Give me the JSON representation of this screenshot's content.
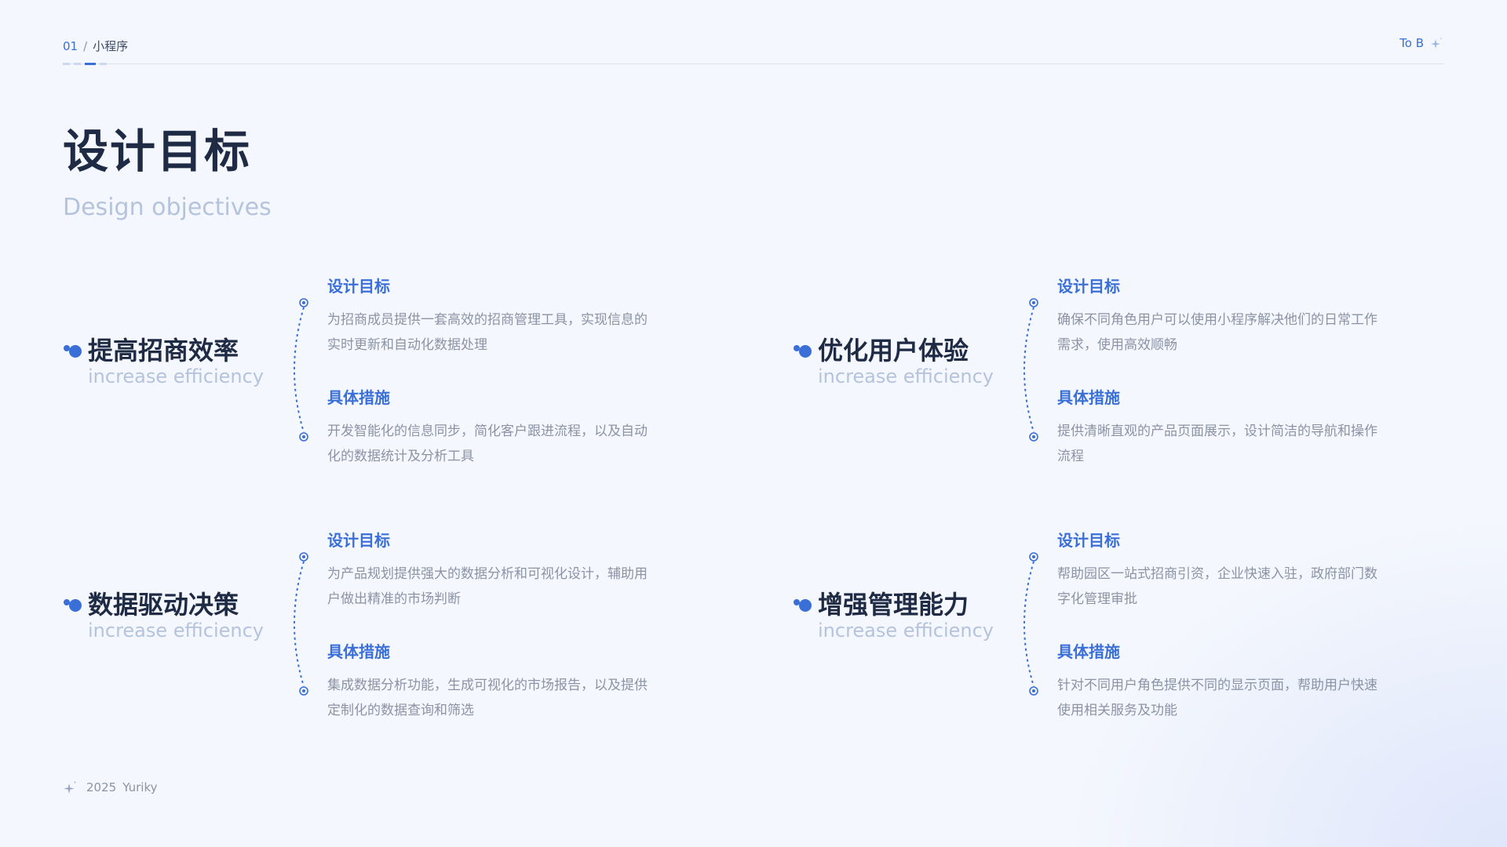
{
  "header": {
    "number": "01",
    "separator": "/",
    "section": "小程序",
    "tag": "To B"
  },
  "title": "设计目标",
  "subtitle": "Design objectives",
  "colors": {
    "accent": "#3a6fd8",
    "title": "#1f2b45",
    "muted": "#b5c3dc",
    "body": "#8b93a5"
  },
  "items": [
    {
      "name": "提高招商效率",
      "en": "increase efficiency",
      "goal_heading": "设计目标",
      "goal_text": "为招商成员提供一套高效的招商管理工具，实现信息的实时更新和自动化数据处理",
      "measure_heading": "具体措施",
      "measure_text": "开发智能化的信息同步，简化客户跟进流程，以及自动化的数据统计及分析工具"
    },
    {
      "name": "优化用户体验",
      "en": "increase efficiency",
      "goal_heading": "设计目标",
      "goal_text": "确保不同角色用户可以使用小程序解决他们的日常工作需求，使用高效顺畅",
      "measure_heading": "具体措施",
      "measure_text": "提供清晰直观的产品页面展示，设计简洁的导航和操作流程"
    },
    {
      "name": "数据驱动决策",
      "en": "increase efficiency",
      "goal_heading": "设计目标",
      "goal_text": "为产品规划提供强大的数据分析和可视化设计，辅助用户做出精准的市场判断",
      "measure_heading": "具体措施",
      "measure_text": "集成数据分析功能，生成可视化的市场报告，以及提供定制化的数据查询和筛选"
    },
    {
      "name": "增强管理能力",
      "en": "increase efficiency",
      "goal_heading": "设计目标",
      "goal_text": "帮助园区一站式招商引资，企业快速入驻，政府部门数字化管理审批",
      "measure_heading": "具体措施",
      "measure_text": "针对不同用户角色提供不同的显示页面，帮助用户快速使用相关服务及功能"
    }
  ],
  "footer": {
    "year": "2025",
    "author": "Yuriky"
  }
}
